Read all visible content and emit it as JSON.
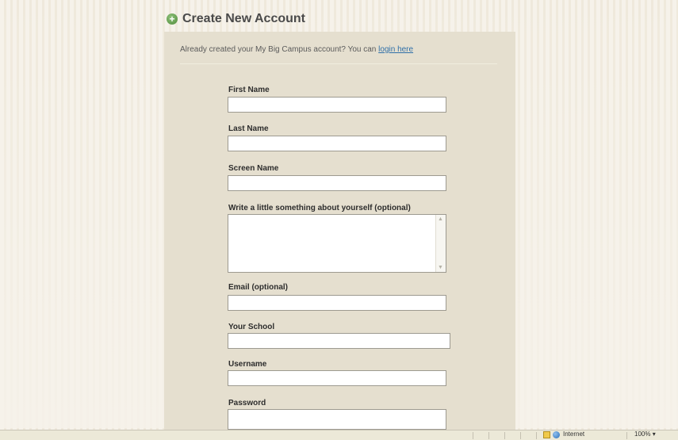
{
  "header": {
    "title": "Create New Account",
    "icon": "plus-circle-icon"
  },
  "intro": {
    "text": "Already created your My Big Campus account? You can ",
    "link_label": "login here"
  },
  "form": {
    "first_name": {
      "label": "First Name",
      "value": ""
    },
    "last_name": {
      "label": "Last Name",
      "value": ""
    },
    "screen_name": {
      "label": "Screen Name",
      "value": ""
    },
    "about": {
      "label": "Write a little something about yourself (optional)",
      "value": ""
    },
    "email": {
      "label": "Email (optional)",
      "value": ""
    },
    "school": {
      "label": "Your School",
      "value": ""
    },
    "username": {
      "label": "Username",
      "value": ""
    },
    "password": {
      "label": "Password",
      "value": ""
    }
  },
  "status_bar": {
    "zone": "Internet",
    "zoom": "100%",
    "zoom_arrow": "▾"
  },
  "colors": {
    "panel_bg": "#e5dfcf",
    "link": "#2f6fa8",
    "title": "#4a4a4a"
  }
}
